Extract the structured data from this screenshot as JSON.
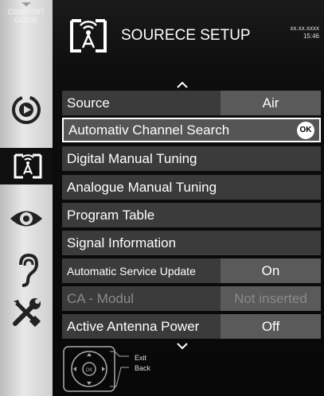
{
  "sidebar": {
    "guide_line1": "COMFORT",
    "guide_line2": "GUIDE",
    "icons": [
      "source-play-icon",
      "antenna-setup-icon",
      "eye-picture-icon",
      "ear-sound-icon",
      "tools-settings-icon"
    ],
    "active_icon": "antenna-setup-icon"
  },
  "header": {
    "title": "SOURECE SETUP",
    "date": "xx.xx.xxxx",
    "time": "15:46"
  },
  "menu": {
    "items": [
      {
        "label": "Source",
        "value": "Air",
        "state": "normal"
      },
      {
        "label": "Automativ Channel Search",
        "value": "",
        "state": "selected",
        "ok": "OK"
      },
      {
        "label": "Digital Manual Tuning",
        "value": "",
        "state": "normal"
      },
      {
        "label": "Analogue Manual Tuning",
        "value": "",
        "state": "normal"
      },
      {
        "label": "Program Table",
        "value": "",
        "state": "normal"
      },
      {
        "label": "Signal Information",
        "value": "",
        "state": "normal"
      },
      {
        "label": "Automatic Service Update",
        "value": "On",
        "state": "normal"
      },
      {
        "label": "CA - Modul",
        "value": "Not inserted",
        "state": "disabled"
      },
      {
        "label": "Active Antenna Power",
        "value": "Off",
        "state": "normal"
      }
    ]
  },
  "legend": {
    "exit_label": "Exit",
    "back_label": "Back",
    "ok_label": "OK"
  },
  "colors": {
    "row_bg": "#3b3b3b",
    "value_bg": "#5a5a5a",
    "selected_border": "#ffffff",
    "disabled_text": "#8a8a8a"
  }
}
